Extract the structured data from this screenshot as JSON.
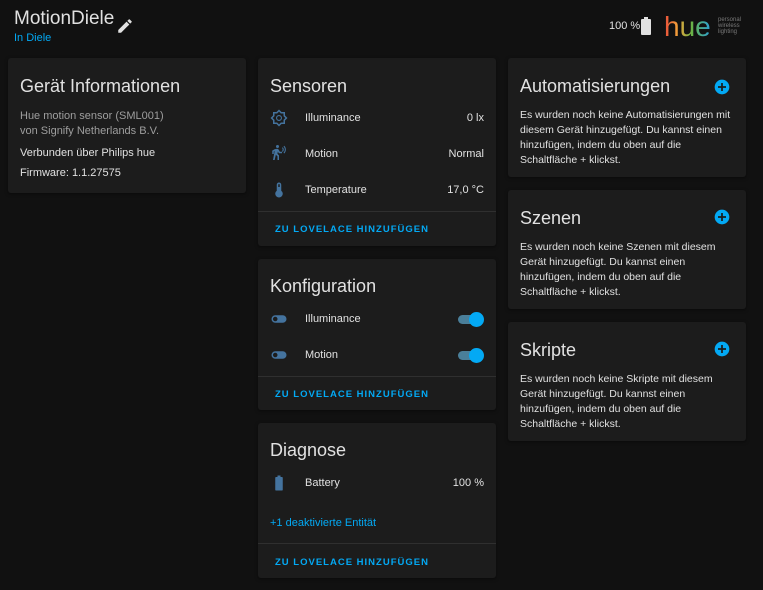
{
  "header": {
    "title": "MotionDiele",
    "area": "In Diele",
    "battery": "100 %",
    "logo_text": "hue",
    "logo_subtext": [
      "personal",
      "wireless",
      "lighting"
    ]
  },
  "device_info": {
    "title": "Gerät Informationen",
    "model": "Hue motion sensor (SML001)",
    "manufacturer": "von Signify Netherlands B.V.",
    "connected": "Verbunden über Philips hue",
    "firmware": "Firmware: 1.1.27575"
  },
  "sensors": {
    "title": "Sensoren",
    "rows": [
      {
        "name": "Illuminance",
        "value": "0 lx",
        "icon": "brightness-icon"
      },
      {
        "name": "Motion",
        "value": "Normal",
        "icon": "motion-sensor-icon"
      },
      {
        "name": "Temperature",
        "value": "17,0 °C",
        "icon": "thermometer-icon"
      }
    ],
    "action": "ZU LOVELACE HINZUFÜGEN"
  },
  "configuration": {
    "title": "Konfiguration",
    "rows": [
      {
        "name": "Illuminance",
        "state": "on",
        "icon": "toggle-switch-icon"
      },
      {
        "name": "Motion",
        "state": "on",
        "icon": "toggle-switch-icon"
      }
    ],
    "action": "ZU LOVELACE HINZUFÜGEN"
  },
  "diagnostics": {
    "title": "Diagnose",
    "rows": [
      {
        "name": "Battery",
        "value": "100 %",
        "icon": "battery-icon"
      }
    ],
    "disabled_link": "+1 deaktivierte Entität",
    "action": "ZU LOVELACE HINZUFÜGEN"
  },
  "automations": {
    "title": "Automatisierungen",
    "text": "Es wurden noch keine Automatisierungen mit diesem Gerät hinzugefügt. Du kannst einen hinzufügen, indem du oben auf die Schaltfläche + klickst."
  },
  "scenes": {
    "title": "Szenen",
    "text": "Es wurden noch keine Szenen mit diesem Gerät hinzugefügt. Du kannst einen hinzufügen, indem du oben auf die Schaltfläche + klickst."
  },
  "scripts": {
    "title": "Skripte",
    "text": "Es wurden noch keine Skripte mit diesem Gerät hinzugefügt. Du kannst einen hinzufügen, indem du oben auf die Schaltfläche + klickst."
  },
  "colors": {
    "accent": "#03a9f4",
    "card": "#1c1c1c",
    "background": "#111111",
    "icon": "#44739e"
  }
}
